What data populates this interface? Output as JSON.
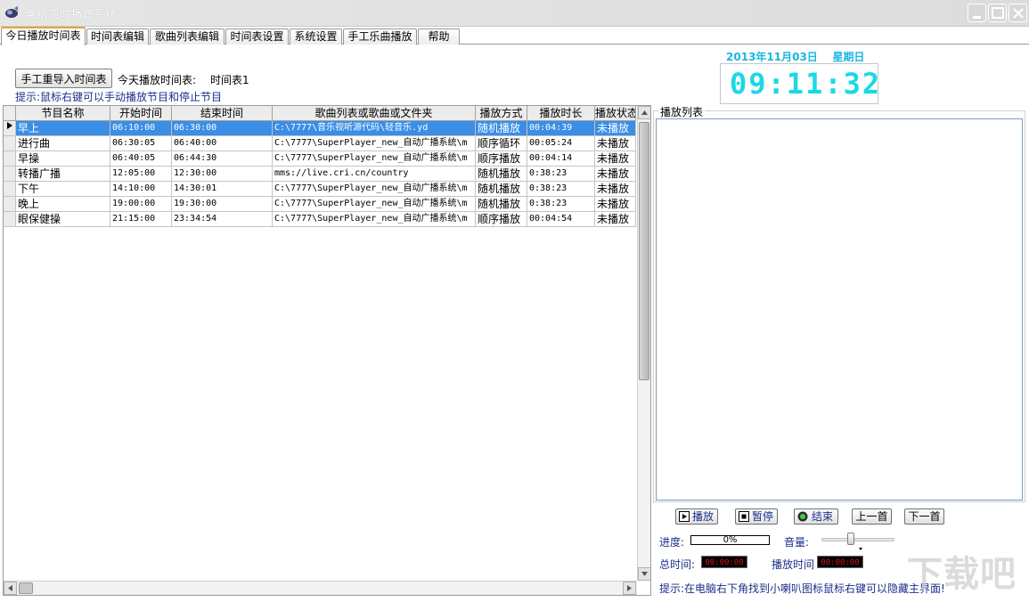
{
  "window": {
    "title": "电脑定时播音系统",
    "icon": "speaker-app-icon"
  },
  "tabs": [
    {
      "label": "今日播放时间表",
      "active": true
    },
    {
      "label": "时间表编辑"
    },
    {
      "label": "歌曲列表编辑"
    },
    {
      "label": "时间表设置"
    },
    {
      "label": "系统设置"
    },
    {
      "label": "手工乐曲播放"
    },
    {
      "label": "帮助"
    }
  ],
  "top": {
    "import_button": "手工重导入时间表",
    "today_label": "今天播放时间表:",
    "today_value": "时间表1",
    "hint": "提示:鼠标右键可以手动播放节目和停止节目",
    "date": "2013年11月03日",
    "weekday": "星期日",
    "clock": "09:11:32"
  },
  "table": {
    "columns": [
      "节目名称",
      "开始时间",
      "结束时间",
      "歌曲列表或歌曲或文件夹",
      "播放方式",
      "播放时长",
      "播放状态"
    ],
    "rows": [
      [
        "早上",
        "06:10:00",
        "06:30:00",
        "C:\\7777\\音乐视听源代码\\轻音乐.yd",
        "随机播放",
        "00:04:39",
        "未播放"
      ],
      [
        "进行曲",
        "06:30:05",
        "06:40:00",
        "C:\\7777\\SuperPlayer_new_自动广播系统\\m",
        "顺序循环",
        "00:05:24",
        "未播放"
      ],
      [
        "早操",
        "06:40:05",
        "06:44:30",
        "C:\\7777\\SuperPlayer_new_自动广播系统\\m",
        "顺序播放",
        "00:04:14",
        "未播放"
      ],
      [
        "转播广播",
        "12:05:00",
        "12:30:00",
        "mms://live.cri.cn/country",
        "随机播放",
        "0:38:23",
        "未播放"
      ],
      [
        "下午",
        "14:10:00",
        "14:30:01",
        "C:\\7777\\SuperPlayer_new_自动广播系统\\m",
        "随机播放",
        "0:38:23",
        "未播放"
      ],
      [
        "晚上",
        "19:00:00",
        "19:30:00",
        "C:\\7777\\SuperPlayer_new_自动广播系统\\m",
        "随机播放",
        "0:38:23",
        "未播放"
      ],
      [
        "眼保健操",
        "21:15:00",
        "23:34:54",
        "C:\\7777\\SuperPlayer_new_自动广播系统\\m",
        "顺序播放",
        "00:04:54",
        "未播放"
      ]
    ],
    "selected_row": 0
  },
  "playlist": {
    "label": "播放列表"
  },
  "controls": {
    "play": "播放",
    "pause": "暂停",
    "stop": "结束",
    "prev": "上一首",
    "next": "下一首",
    "progress_label": "进度:",
    "progress_value": "0%",
    "volume_label": "音量:",
    "volume_level": 0.38,
    "total_label": "总时间:",
    "total_time": "00:00:00",
    "play_time_label": "播放时间",
    "play_time": "00:00:00",
    "hint": "提示:在电脑右下角找到小喇叭图标鼠标右键可以隐藏主界面!"
  },
  "watermark": "下载吧",
  "colors": {
    "accent_clock": "#19d9e6",
    "date_color": "#19b7e0",
    "selection": "#3a8ee6",
    "hint_text": "#1b2f8a"
  }
}
